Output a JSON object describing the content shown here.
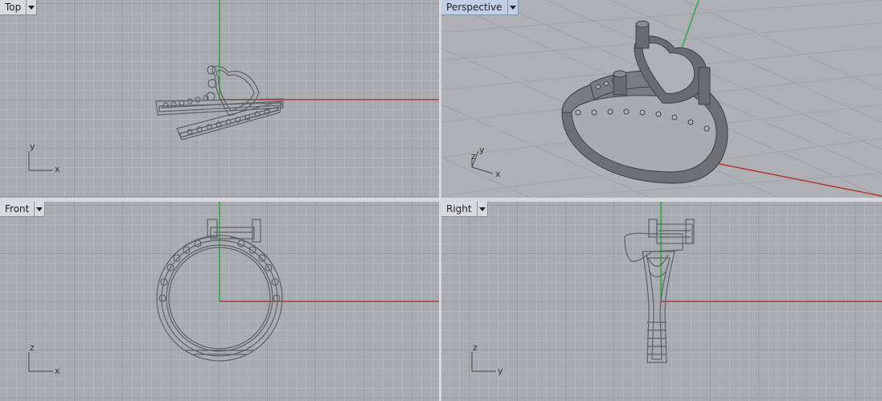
{
  "viewports": {
    "top": {
      "label": "Top",
      "axis_h": "x",
      "axis_v": "y"
    },
    "perspective": {
      "label": "Perspective",
      "axis_h": "x",
      "axis_v": "y",
      "axis_z": "z"
    },
    "front": {
      "label": "Front",
      "axis_h": "x",
      "axis_v": "z"
    },
    "right": {
      "label": "Right",
      "axis_h": "y",
      "axis_v": "z"
    }
  },
  "colors": {
    "x_axis": "#b23a3a",
    "y_axis": "#2fa84a",
    "wire": "#5f6064",
    "active_tab": "#c0cfe6"
  }
}
